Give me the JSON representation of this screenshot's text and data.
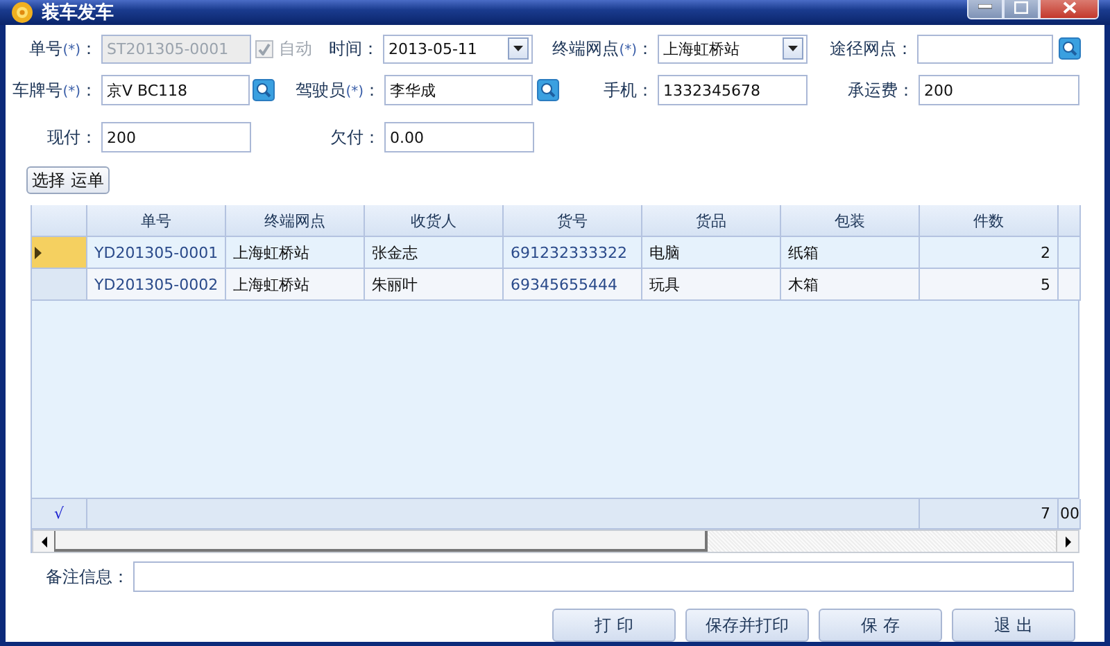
{
  "window": {
    "title": "装车发车"
  },
  "form": {
    "rows": [
      [
        {
          "kind": "text",
          "label": "单号",
          "required_mark": "(*)",
          "suffix": "：",
          "value": "ST201305-0001",
          "disabled": true,
          "auto_checkbox": {
            "label": "自动",
            "checked": true,
            "disabled": true
          }
        },
        {
          "kind": "combo",
          "label": "时间：",
          "value": "2013-05-11"
        },
        {
          "kind": "combo",
          "label": "终端网点",
          "required_mark": "(*)",
          "suffix": "：",
          "value": "上海虹桥站"
        },
        {
          "kind": "lookup",
          "label": "途径网点："
        }
      ],
      [
        {
          "kind": "lookup",
          "label": "车牌号",
          "required_mark": "(*)",
          "suffix": "：",
          "value": "京V BC118"
        },
        {
          "kind": "lookup",
          "label": "驾驶员",
          "required_mark": "(*)",
          "suffix": "：",
          "value": "李华成"
        },
        {
          "kind": "text",
          "label": "手机：",
          "value": "1332345678"
        },
        {
          "kind": "text",
          "label": "承运费：",
          "value": "200"
        }
      ],
      [
        {
          "kind": "text",
          "label": "现付：",
          "value": "200"
        },
        {
          "kind": "text",
          "label": "欠付：",
          "value": "0.00"
        }
      ]
    ]
  },
  "choose_button": "选择 运单",
  "table": {
    "columns": [
      "单号",
      "终端网点",
      "收货人",
      "货号",
      "货品",
      "包装",
      "件数"
    ],
    "rows": [
      {
        "selected": true,
        "cells": [
          "YD201305-0001",
          "上海虹桥站",
          "张金志",
          "691232333322",
          "电脑",
          "纸箱",
          "2"
        ]
      },
      {
        "selected": false,
        "cells": [
          "YD201305-0002",
          "上海虹桥站",
          "朱丽叶",
          "69345655444",
          "玩具",
          "木箱",
          "5"
        ]
      }
    ],
    "footer": {
      "indicator": "√",
      "total": "7",
      "column_8": "00"
    }
  },
  "remark": {
    "label": "备注信息："
  },
  "buttons": [
    "打 印",
    "保存并打印",
    "保 存",
    "退 出"
  ]
}
